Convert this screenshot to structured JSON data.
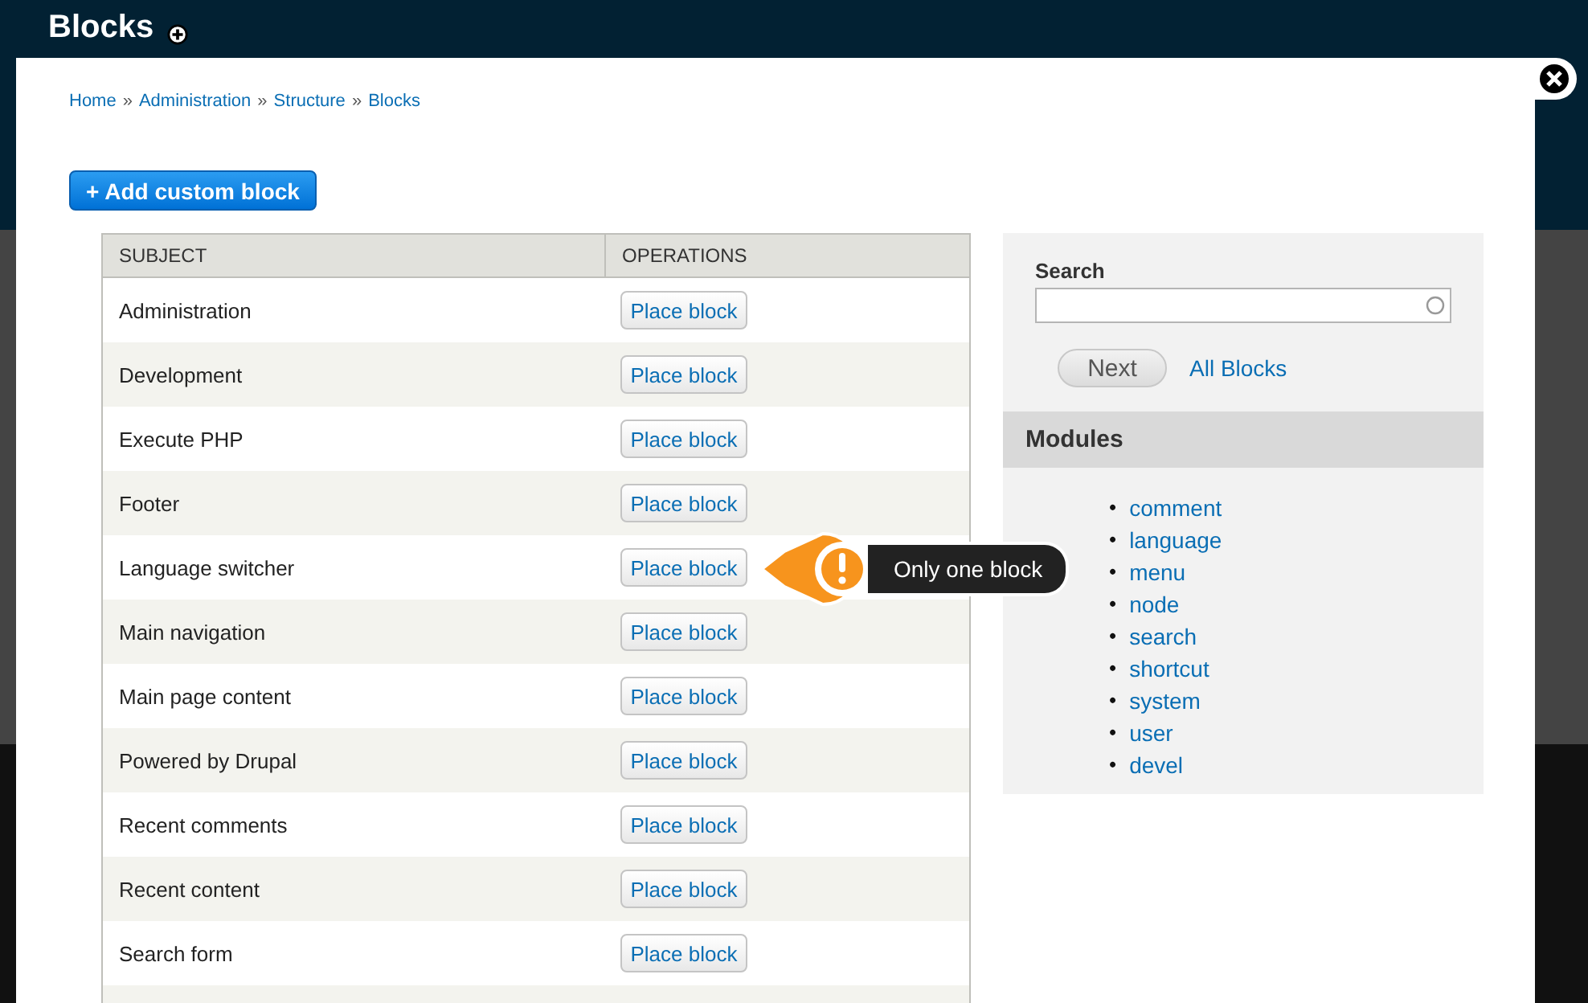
{
  "page": {
    "title": "Blocks"
  },
  "dialog": {
    "breadcrumb": [
      "Home",
      "Administration",
      "Structure",
      "Blocks"
    ],
    "breadcrumb_separator": "»",
    "add_button": "+ Add custom block",
    "table": {
      "columns": [
        "SUBJECT",
        "OPERATIONS"
      ],
      "rows": [
        {
          "subject": "Administration",
          "operation": "Place block"
        },
        {
          "subject": "Development",
          "operation": "Place block"
        },
        {
          "subject": "Execute PHP",
          "operation": "Place block"
        },
        {
          "subject": "Footer",
          "operation": "Place block"
        },
        {
          "subject": "Language switcher",
          "operation": "Place block",
          "tooltip": "Only one block"
        },
        {
          "subject": "Main navigation",
          "operation": "Place block"
        },
        {
          "subject": "Main page content",
          "operation": "Place block"
        },
        {
          "subject": "Powered by Drupal",
          "operation": "Place block"
        },
        {
          "subject": "Recent comments",
          "operation": "Place block"
        },
        {
          "subject": "Recent content",
          "operation": "Place block"
        },
        {
          "subject": "Search form",
          "operation": "Place block"
        }
      ]
    },
    "sidebar": {
      "search_label": "Search",
      "next_button": "Next",
      "all_link": "All Blocks",
      "modules_title": "Modules",
      "bullet": "•",
      "modules": [
        "comment",
        "language",
        "menu",
        "node",
        "search",
        "shortcut",
        "system",
        "user",
        "devel"
      ]
    }
  }
}
